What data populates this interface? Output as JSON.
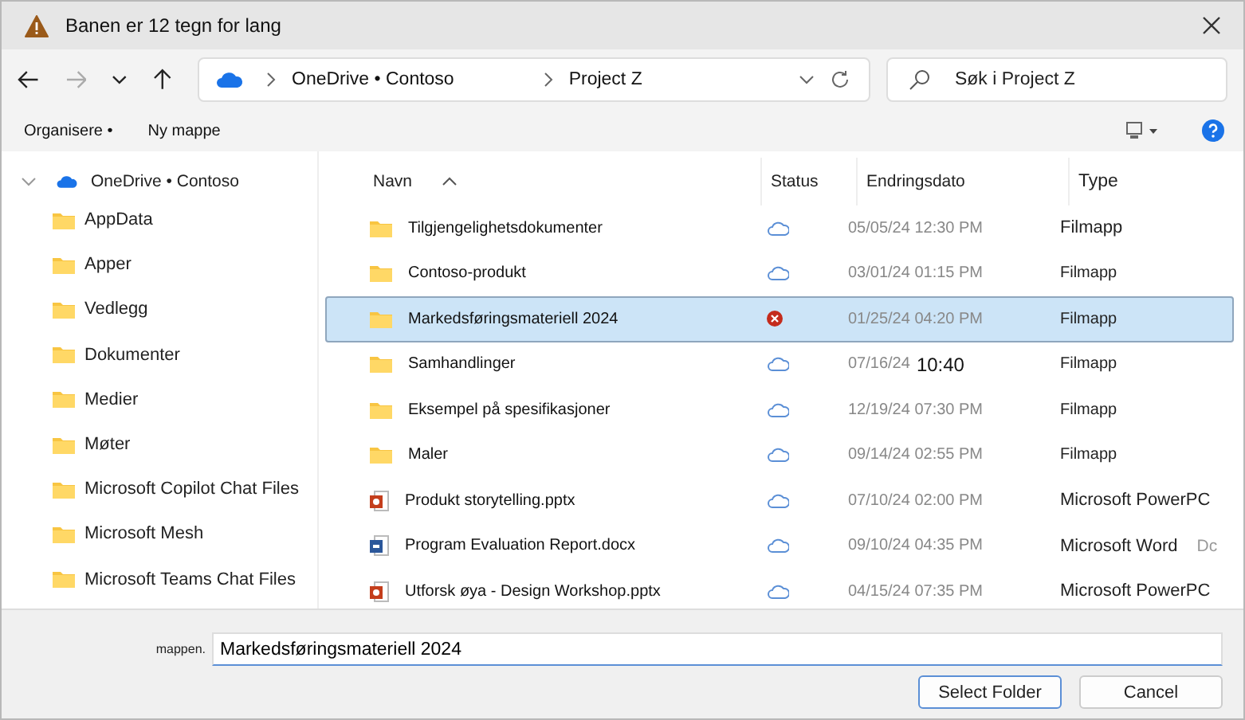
{
  "window": {
    "title": "Banen er 12 tegn for lang"
  },
  "breadcrumb": [
    "OneDrive • Contoso",
    "Project Z"
  ],
  "search": {
    "placeholder": "Søk i Project Z"
  },
  "toolbar": [
    "Organisere •",
    "Ny mappe"
  ],
  "sidebar": {
    "root": {
      "label": "OneDrive • Contoso",
      "expanded": true
    },
    "items": [
      "AppData",
      "Apper",
      "Vedlegg",
      "Dokumenter",
      "Medier",
      "Møter",
      "Microsoft Copilot Chat Files",
      "Microsoft Mesh",
      "Microsoft Teams Chat Files"
    ]
  },
  "table": {
    "columns": [
      "Navn",
      "Status",
      "Endringsdato",
      "Type"
    ],
    "rows": [
      {
        "kind": "folder",
        "name": "Tilgjengelighetsdokumenter",
        "status": {
          "kind": "cloud"
        },
        "date": "05/05/24 12:30 PM",
        "type": "Filmapp",
        "selected": false
      },
      {
        "kind": "folder",
        "name": "Contoso-produkt",
        "status": {
          "kind": "cloud"
        },
        "date": "03/01/24 01:15 PM",
        "type": "Filmapp",
        "selected": false
      },
      {
        "kind": "folder",
        "name": "Markedsføringsmateriell 2024",
        "status": {
          "kind": "error"
        },
        "date": "01/25/24 04:20 PM",
        "type": "Filmapp",
        "selected": true
      },
      {
        "kind": "folder",
        "name": "Samhandlinger",
        "status": {
          "kind": "cloud"
        },
        "date": "07/16/24",
        "time": "10:40",
        "type": "Filmapp",
        "selected": false
      },
      {
        "kind": "folder",
        "name": "Eksempel på spesifikasjoner",
        "status": {
          "kind": "cloud"
        },
        "date": "12/19/24 07:30 PM",
        "type": "Filmapp",
        "selected": false
      },
      {
        "kind": "folder",
        "name": "Maler",
        "status": {
          "kind": "cloud"
        },
        "date": "09/14/24 02:55 PM",
        "type": "Filmapp",
        "selected": false
      },
      {
        "kind": "pptx",
        "name": "Produkt storytelling.pptx",
        "status": {
          "kind": "cloud"
        },
        "date": "07/10/24 02:00 PM",
        "type": "Microsoft PowerPC",
        "selected": false
      },
      {
        "kind": "docx",
        "name": "Program Evaluation Report.docx",
        "status": {
          "kind": "cloud"
        },
        "date": "09/10/24 04:35 PM",
        "type": "Microsoft Word",
        "column_5": "Dc",
        "selected": false
      },
      {
        "kind": "pptx",
        "name": "Utforsk øya - Design Workshop.pptx",
        "status": {
          "kind": "cloud"
        },
        "date": "04/15/24 07:35 PM",
        "type": "Microsoft PowerPC",
        "selected": false
      }
    ]
  },
  "footer": {
    "label": "mappen.",
    "value": "Markedsføringsmateriell 2024",
    "buttons": [
      "Select Folder",
      "Cancel"
    ]
  }
}
